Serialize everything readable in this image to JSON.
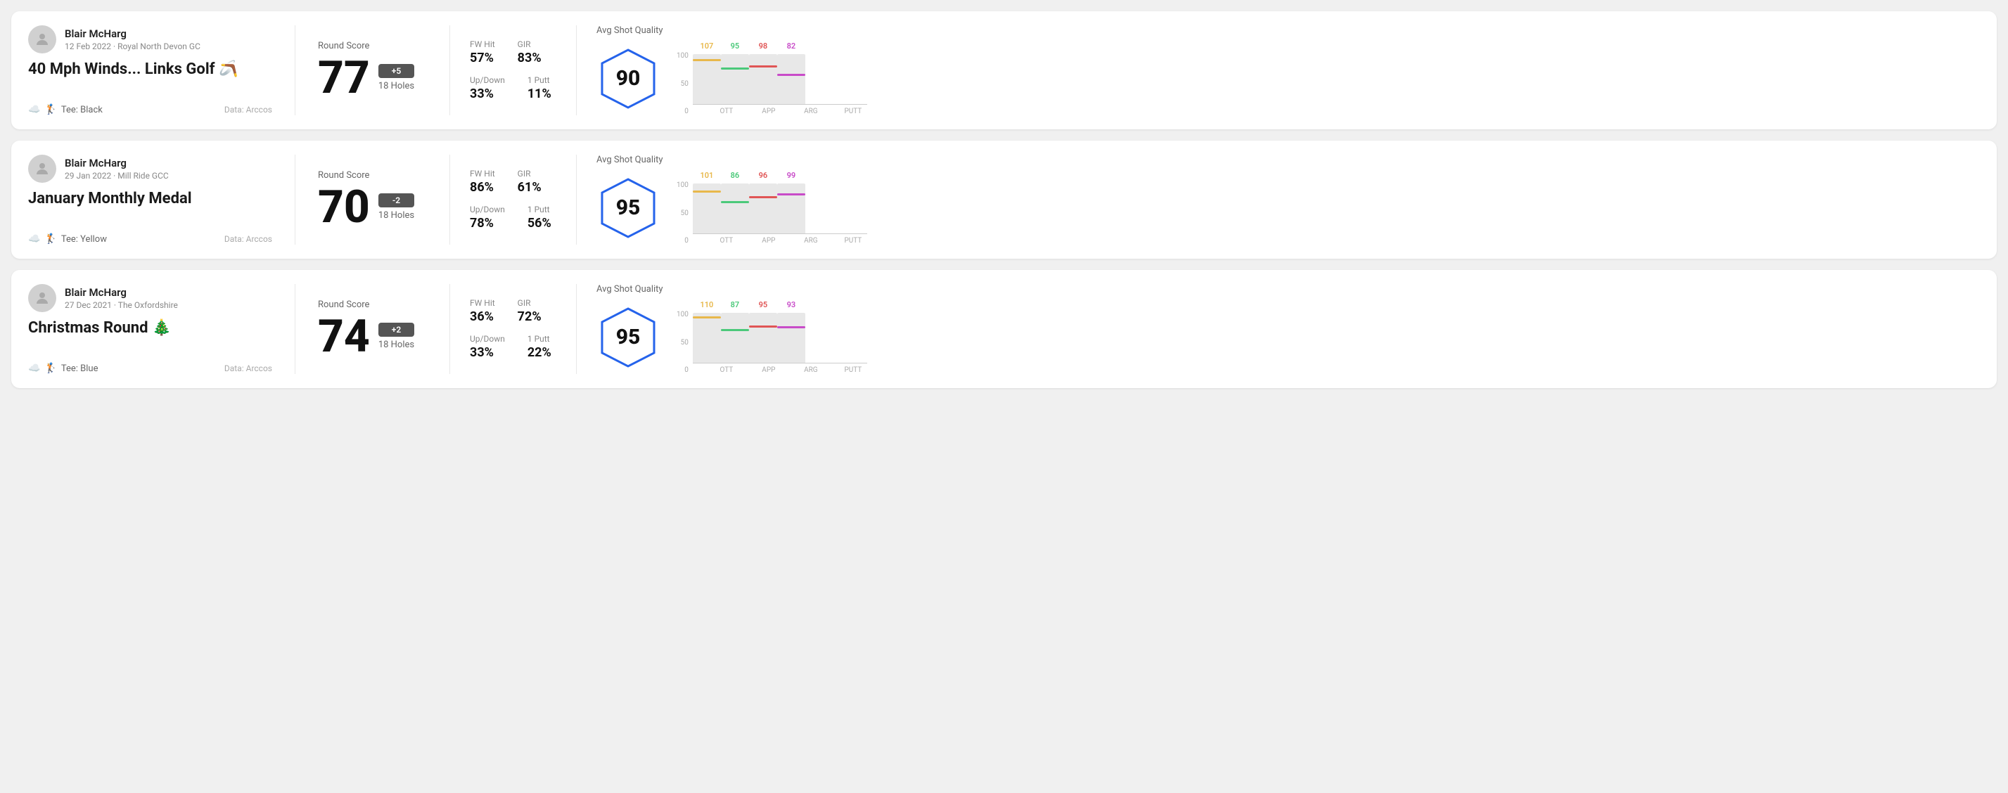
{
  "rounds": [
    {
      "id": "round-1",
      "user": {
        "name": "Blair McHarg",
        "date_course": "12 Feb 2022 · Royal North Devon GC"
      },
      "title": "40 Mph Winds... Links Golf 🪃",
      "tee": "Black",
      "data_source": "Data: Arccos",
      "score": {
        "value": "77",
        "diff": "+5",
        "holes": "18 Holes"
      },
      "stats": {
        "fw_hit_label": "FW Hit",
        "fw_hit_value": "57%",
        "gir_label": "GIR",
        "gir_value": "83%",
        "updown_label": "Up/Down",
        "updown_value": "33%",
        "oneputt_label": "1 Putt",
        "oneputt_value": "11%"
      },
      "quality": {
        "label": "Avg Shot Quality",
        "score": "90",
        "bars": [
          {
            "label": "OTT",
            "top_value": "107",
            "top_color": "#e8b84b",
            "fill_pct": 85
          },
          {
            "label": "APP",
            "top_value": "95",
            "top_color": "#4bc97a",
            "fill_pct": 68
          },
          {
            "label": "ARG",
            "top_value": "98",
            "top_color": "#e05555",
            "fill_pct": 72
          },
          {
            "label": "PUTT",
            "top_value": "82",
            "top_color": "#c84bc8",
            "fill_pct": 55
          }
        ]
      }
    },
    {
      "id": "round-2",
      "user": {
        "name": "Blair McHarg",
        "date_course": "29 Jan 2022 · Mill Ride GCC"
      },
      "title": "January Monthly Medal",
      "tee": "Yellow",
      "data_source": "Data: Arccos",
      "score": {
        "value": "70",
        "diff": "-2",
        "holes": "18 Holes"
      },
      "stats": {
        "fw_hit_label": "FW Hit",
        "fw_hit_value": "86%",
        "gir_label": "GIR",
        "gir_value": "61%",
        "updown_label": "Up/Down",
        "updown_value": "78%",
        "oneputt_label": "1 Putt",
        "oneputt_value": "56%"
      },
      "quality": {
        "label": "Avg Shot Quality",
        "score": "95",
        "bars": [
          {
            "label": "OTT",
            "top_value": "101",
            "top_color": "#e8b84b",
            "fill_pct": 80
          },
          {
            "label": "APP",
            "top_value": "86",
            "top_color": "#4bc97a",
            "fill_pct": 60
          },
          {
            "label": "ARG",
            "top_value": "96",
            "top_color": "#e05555",
            "fill_pct": 70
          },
          {
            "label": "PUTT",
            "top_value": "99",
            "top_color": "#c84bc8",
            "fill_pct": 75
          }
        ]
      }
    },
    {
      "id": "round-3",
      "user": {
        "name": "Blair McHarg",
        "date_course": "27 Dec 2021 · The Oxfordshire"
      },
      "title": "Christmas Round 🎄",
      "tee": "Blue",
      "data_source": "Data: Arccos",
      "score": {
        "value": "74",
        "diff": "+2",
        "holes": "18 Holes"
      },
      "stats": {
        "fw_hit_label": "FW Hit",
        "fw_hit_value": "36%",
        "gir_label": "GIR",
        "gir_value": "72%",
        "updown_label": "Up/Down",
        "updown_value": "33%",
        "oneputt_label": "1 Putt",
        "oneputt_value": "22%"
      },
      "quality": {
        "label": "Avg Shot Quality",
        "score": "95",
        "bars": [
          {
            "label": "OTT",
            "top_value": "110",
            "top_color": "#e8b84b",
            "fill_pct": 88
          },
          {
            "label": "APP",
            "top_value": "87",
            "top_color": "#4bc97a",
            "fill_pct": 62
          },
          {
            "label": "ARG",
            "top_value": "95",
            "top_color": "#e05555",
            "fill_pct": 70
          },
          {
            "label": "PUTT",
            "top_value": "93",
            "top_color": "#c84bc8",
            "fill_pct": 68
          }
        ]
      }
    }
  ],
  "chart": {
    "y_labels": [
      "100",
      "50",
      "0"
    ]
  }
}
